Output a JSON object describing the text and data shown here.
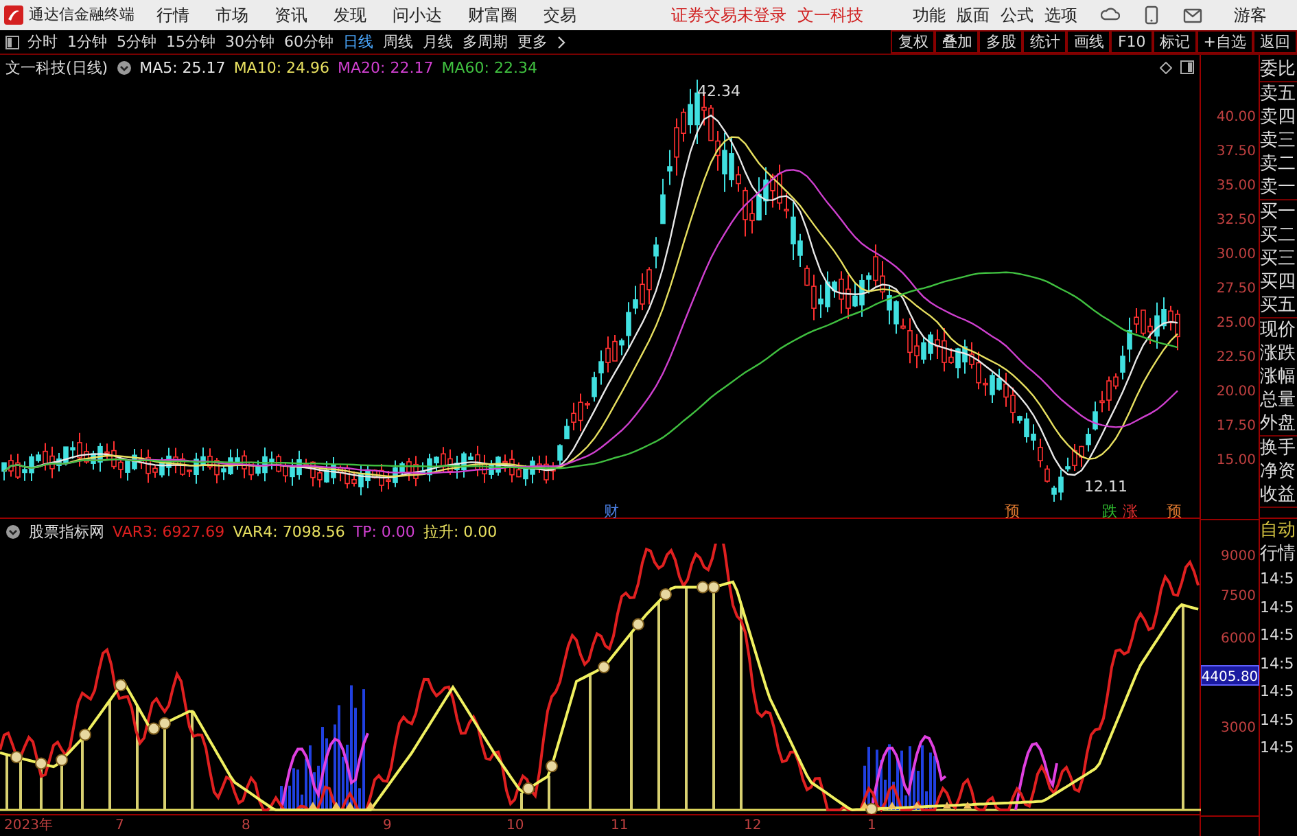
{
  "title_bar": {
    "app_name": "通达信金融终端",
    "menu": [
      "行情",
      "市场",
      "资讯",
      "发现",
      "问小达",
      "财富圈",
      "交易"
    ],
    "notice": "证券交易未登录",
    "stock": "文一科技",
    "tools": [
      "功能",
      "版面",
      "公式",
      "选项"
    ],
    "user": "游客"
  },
  "toolbar": {
    "periods": [
      {
        "label": "分时",
        "selected": false
      },
      {
        "label": "1分钟",
        "selected": false
      },
      {
        "label": "5分钟",
        "selected": false
      },
      {
        "label": "15分钟",
        "selected": false
      },
      {
        "label": "30分钟",
        "selected": false
      },
      {
        "label": "60分钟",
        "selected": false
      },
      {
        "label": "日线",
        "selected": true
      },
      {
        "label": "周线",
        "selected": false
      },
      {
        "label": "月线",
        "selected": false
      },
      {
        "label": "多周期",
        "selected": false
      }
    ],
    "more": "更多",
    "actions": [
      "复权",
      "叠加",
      "多股",
      "统计",
      "画线",
      "F10",
      "标记",
      "+自选",
      "返回"
    ]
  },
  "main_chart": {
    "title": "文一科技(日线)",
    "legend": [
      {
        "label": "MA5: 25.17",
        "color": "#e8e8e8"
      },
      {
        "label": "MA10: 24.96",
        "color": "#e8e060"
      },
      {
        "label": "MA20: 22.17",
        "color": "#d040d0"
      },
      {
        "label": "MA60: 22.34",
        "color": "#40c040"
      }
    ],
    "axis_labels": [
      "40.00",
      "37.50",
      "35.00",
      "32.50",
      "30.00",
      "27.50",
      "25.00",
      "22.50",
      "20.00",
      "17.50",
      "15.00"
    ],
    "high_label": "42.34",
    "low_label": "12.11",
    "events": [
      {
        "label": "财",
        "color": "#4a7ee0"
      },
      {
        "label": "预",
        "color": "#e07a30"
      },
      {
        "label": "跌",
        "color": "#30c030"
      },
      {
        "label": "涨",
        "color": "#e03030"
      },
      {
        "label": "预",
        "color": "#e07a30"
      }
    ]
  },
  "indicator": {
    "title": "股票指标网",
    "legend": [
      {
        "label": "VAR3: 6927.69",
        "color": "#e02020"
      },
      {
        "label": "VAR4: 7098.56",
        "color": "#e8e060"
      },
      {
        "label": "TP: 0.00",
        "color": "#d040d0"
      },
      {
        "label": "拉升: 0.00",
        "color": "#e8e060"
      }
    ],
    "axis_labels": [
      "9000",
      "7500",
      "6000",
      "3000"
    ],
    "current_value": "4405.80"
  },
  "date_axis": [
    "2023年",
    "7",
    "8",
    "9",
    "10",
    "11",
    "12",
    "1"
  ],
  "side_panel": {
    "quote_groups": [
      {
        "labels": [
          "委比"
        ]
      },
      {
        "labels": [
          "卖五",
          "卖四",
          "卖三",
          "卖二",
          "卖一"
        ]
      },
      {
        "labels": [
          "买一",
          "买二",
          "买三",
          "买四",
          "买五"
        ]
      },
      {
        "labels": [
          "现价",
          "涨跌",
          "涨幅",
          "总量",
          "外盘"
        ]
      },
      {
        "labels": [
          "换手",
          "净资",
          "收益"
        ]
      }
    ],
    "indicator_labels": [
      "自动",
      "行情"
    ],
    "times": [
      "14:5",
      "14:5",
      "14:5",
      "14:5",
      "14:5",
      "14:5",
      "14:5"
    ]
  }
}
